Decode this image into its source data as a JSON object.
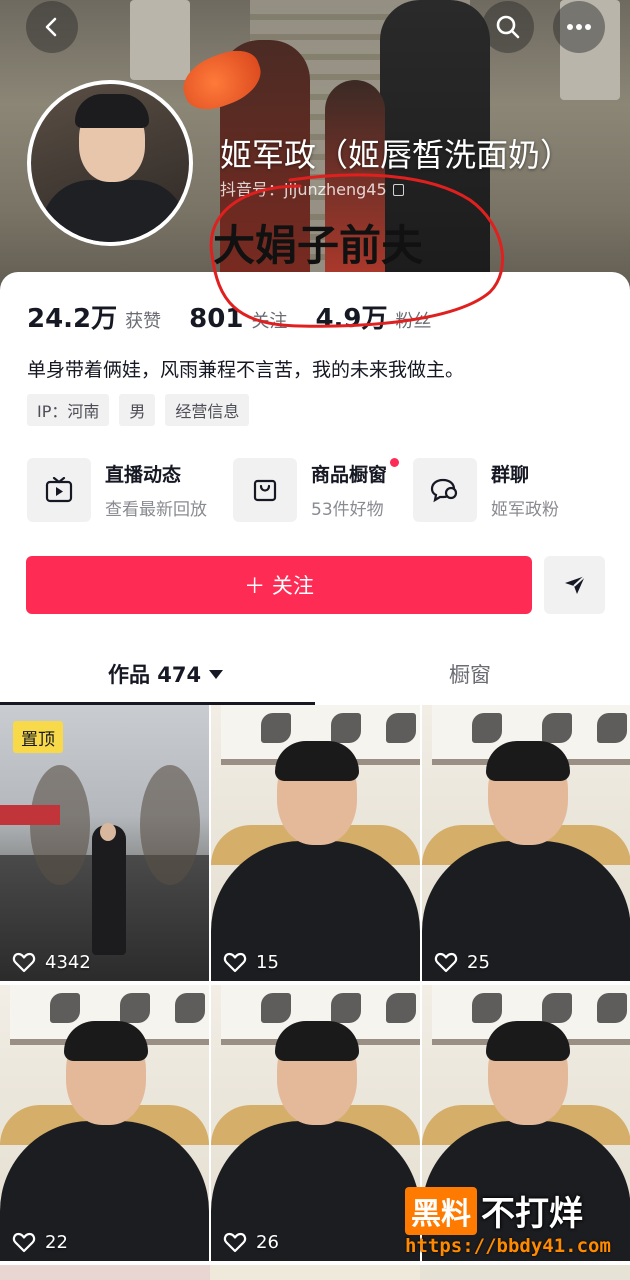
{
  "header": {
    "nickname": "姬军政（姬唇皙洗面奶）",
    "douyin_id": "抖音号：jijunzheng45",
    "annotation": "大娟子前夫",
    "back_icon": "back-arrow-icon",
    "search_icon": "search-icon",
    "more_icon": "more-icon"
  },
  "stats": [
    {
      "num": "24.2万",
      "label": "获赞"
    },
    {
      "num": "801",
      "label": "关注"
    },
    {
      "num": "4.9万",
      "label": "粉丝"
    }
  ],
  "bio": "单身带着俩娃，风雨兼程不言苦，我的未来我做主。",
  "tags": [
    "IP：河南",
    "男",
    "经营信息"
  ],
  "features": [
    {
      "title": "直播动态",
      "subtitle": "查看最新回放",
      "icon": "live-tv-icon"
    },
    {
      "title": "商品橱窗",
      "subtitle": "53件好物",
      "icon": "shopping-bag-icon"
    },
    {
      "title": "群聊",
      "subtitle": "姬军政粉",
      "icon": "chat-icon"
    }
  ],
  "actions": {
    "follow": "＋ 关注",
    "share_icon": "send-icon"
  },
  "tabs": {
    "works": "作品 474",
    "window": "橱窗"
  },
  "videos": [
    {
      "pinned": "置顶",
      "likes": "4342"
    },
    {
      "likes": "15"
    },
    {
      "likes": "25"
    },
    {
      "likes": "22"
    },
    {
      "likes": "26"
    },
    {
      "likes": ""
    }
  ],
  "watermark": {
    "box": "黑料",
    "text": "不打烊",
    "url": "https://bbdy41.com"
  },
  "colors": {
    "accent": "#fe2c55",
    "pin": "#f7d94a",
    "annotation_circle": "#e0201f",
    "watermark": "#ff7a00"
  }
}
